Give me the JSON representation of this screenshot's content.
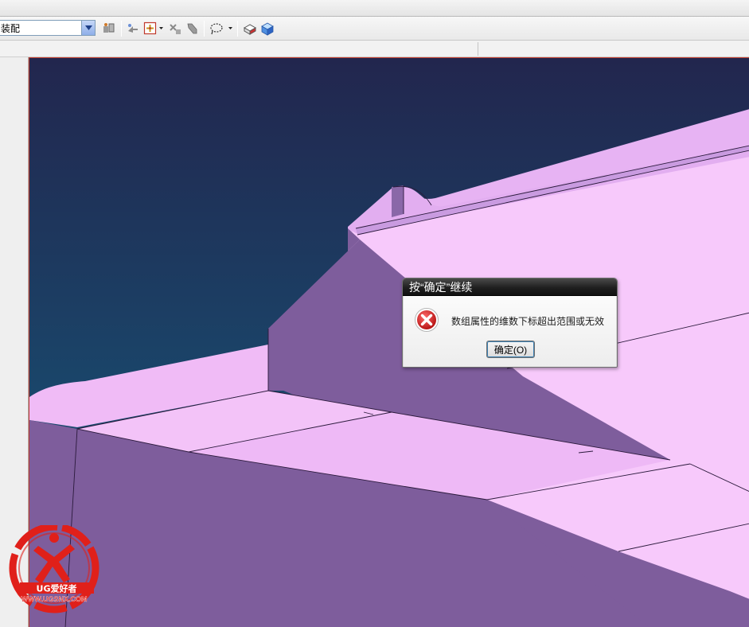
{
  "toolbar": {
    "combo_value": "装配",
    "icons": [
      "assembly-constraint-icon",
      "move-component-icon",
      "snap-point-icon",
      "transform-icon",
      "reposition-icon",
      "lasso-select-icon",
      "view-orient-icon",
      "shaded-cube-icon"
    ]
  },
  "dialog": {
    "title": "按“确定”继续",
    "message": "数组属性的维数下标超出范围或无效",
    "ok_label": "确定(O)",
    "icon": "error-icon"
  },
  "watermark": {
    "brand_text": "UG爱好者",
    "url_text": "WWW.UGSNX.COM"
  },
  "colors": {
    "viewport_top": "#22264e",
    "viewport_bottom": "#145c7e",
    "model_light": "#f7c9fb",
    "model_mid": "#e7b3f3",
    "model_dark": "#7e5d9c",
    "error_red": "#d42020",
    "watermark_red": "#e0201a"
  }
}
